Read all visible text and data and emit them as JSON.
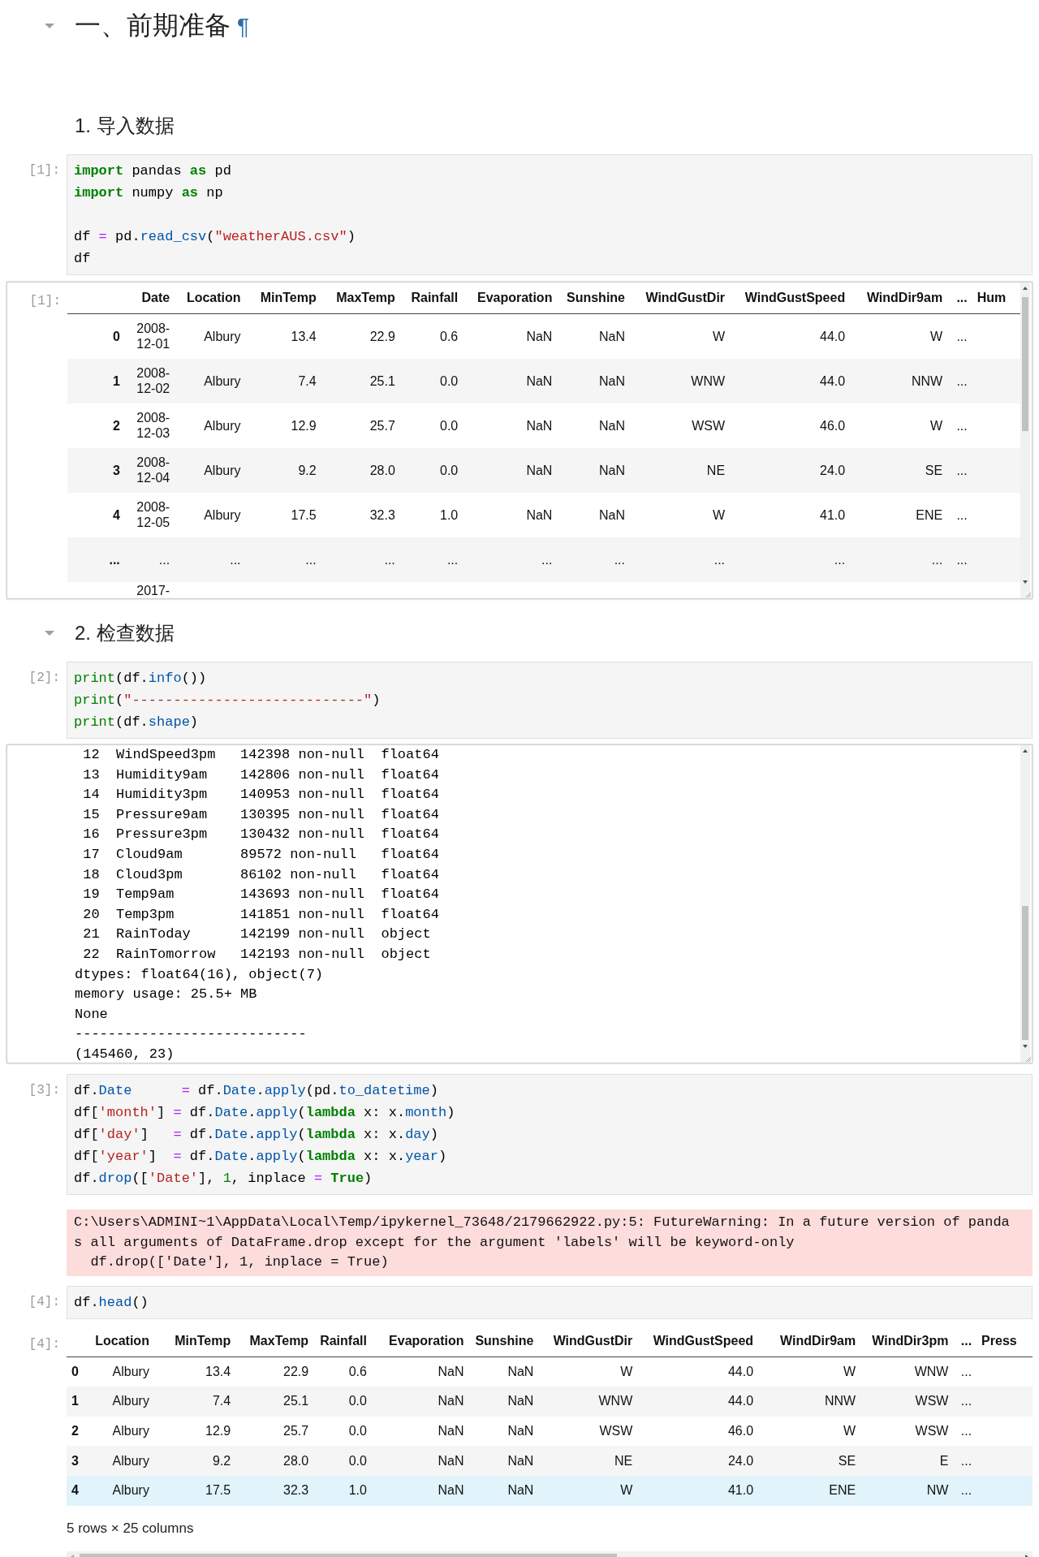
{
  "cells": [
    {
      "kind": "title",
      "text": "一、前期准备",
      "anchor": "¶",
      "expanded": true
    },
    {
      "kind": "section",
      "text": "1. 导入数据"
    },
    {
      "kind": "code",
      "prompt": "[1]:",
      "groups": [
        [
          [
            {
              "kind": "kw",
              "text": "import"
            },
            {
              "kind": "plain",
              "text": " pandas "
            },
            {
              "kind": "kw",
              "text": "as"
            },
            {
              "kind": "plain",
              "text": " pd"
            }
          ],
          [
            {
              "kind": "kw",
              "text": "import"
            },
            {
              "kind": "plain",
              "text": " numpy "
            },
            {
              "kind": "kw",
              "text": "as"
            },
            {
              "kind": "plain",
              "text": " np"
            }
          ]
        ],
        [
          [
            {
              "kind": "plain",
              "text": "df "
            },
            {
              "kind": "op",
              "text": "="
            },
            {
              "kind": "plain",
              "text": " pd."
            },
            {
              "kind": "fn",
              "text": "read_csv"
            },
            {
              "kind": "plain",
              "text": "("
            },
            {
              "kind": "str",
              "text": "\"weatherAUS.csv\""
            },
            {
              "kind": "plain",
              "text": ")"
            }
          ],
          [
            {
              "kind": "plain",
              "text": "df"
            }
          ]
        ]
      ]
    },
    {
      "kind": "scrolled_table",
      "prompt": "[1]:",
      "columns": [
        "Date",
        "Location",
        "MinTemp",
        "MaxTemp",
        "Rainfall",
        "Evaporation",
        "Sunshine",
        "WindGustDir",
        "WindGustSpeed",
        "WindDir9am",
        "...",
        "Hum"
      ],
      "rows": [
        {
          "index": "0",
          "cells": [
            "2008-12-01",
            "Albury",
            "13.4",
            "22.9",
            "0.6",
            "NaN",
            "NaN",
            "W",
            "44.0",
            "W",
            "..."
          ]
        },
        {
          "index": "1",
          "cells": [
            "2008-12-02",
            "Albury",
            "7.4",
            "25.1",
            "0.0",
            "NaN",
            "NaN",
            "WNW",
            "44.0",
            "NNW",
            "..."
          ]
        },
        {
          "index": "2",
          "cells": [
            "2008-12-03",
            "Albury",
            "12.9",
            "25.7",
            "0.0",
            "NaN",
            "NaN",
            "WSW",
            "46.0",
            "W",
            "..."
          ]
        },
        {
          "index": "3",
          "cells": [
            "2008-12-04",
            "Albury",
            "9.2",
            "28.0",
            "0.0",
            "NaN",
            "NaN",
            "NE",
            "24.0",
            "SE",
            "..."
          ]
        },
        {
          "index": "4",
          "cells": [
            "2008-12-05",
            "Albury",
            "17.5",
            "32.3",
            "1.0",
            "NaN",
            "NaN",
            "W",
            "41.0",
            "ENE",
            "..."
          ]
        },
        {
          "index": "...",
          "cells": [
            "...",
            "...",
            "...",
            "...",
            "...",
            "...",
            "...",
            "...",
            "...",
            "...",
            "..."
          ]
        },
        {
          "cells": [
            "2017-"
          ]
        }
      ]
    },
    {
      "kind": "section",
      "text": "2. 检查数据",
      "expanded": true
    },
    {
      "kind": "code",
      "prompt": "[2]:",
      "groups": [
        [
          [
            {
              "kind": "bi",
              "text": "print"
            },
            {
              "kind": "plain",
              "text": "(df."
            },
            {
              "kind": "fn",
              "text": "info"
            },
            {
              "kind": "plain",
              "text": "())"
            }
          ],
          [
            {
              "kind": "bi",
              "text": "print"
            },
            {
              "kind": "plain",
              "text": "("
            },
            {
              "kind": "str",
              "text": "\"----------------------------\""
            },
            {
              "kind": "plain",
              "text": ")"
            }
          ],
          [
            {
              "kind": "bi",
              "text": "print"
            },
            {
              "kind": "plain",
              "text": "(df."
            },
            {
              "kind": "fn",
              "text": "shape"
            },
            {
              "kind": "plain",
              "text": ")"
            }
          ]
        ]
      ]
    },
    {
      "kind": "stream",
      "lines": [
        " 12  WindSpeed3pm   142398 non-null  float64",
        " 13  Humidity9am    142806 non-null  float64",
        " 14  Humidity3pm    140953 non-null  float64",
        " 15  Pressure9am    130395 non-null  float64",
        " 16  Pressure3pm    130432 non-null  float64",
        " 17  Cloud9am       89572 non-null   float64",
        " 18  Cloud3pm       86102 non-null   float64",
        " 19  Temp9am        143693 non-null  float64",
        " 20  Temp3pm        141851 non-null  float64",
        " 21  RainToday      142199 non-null  object",
        " 22  RainTomorrow   142193 non-null  object",
        "dtypes: float64(16), object(7)",
        "memory usage: 25.5+ MB",
        "None",
        "----------------------------",
        "(145460, 23)"
      ]
    },
    {
      "kind": "code",
      "prompt": "[3]:",
      "groups": [
        [
          [
            {
              "kind": "plain",
              "text": "df."
            },
            {
              "kind": "fn",
              "text": "Date"
            },
            {
              "kind": "op",
              "text": "      ="
            },
            {
              "kind": "plain",
              "text": " df."
            },
            {
              "kind": "fn",
              "text": "Date"
            },
            {
              "kind": "plain",
              "text": "."
            },
            {
              "kind": "fn",
              "text": "apply"
            },
            {
              "kind": "plain",
              "text": "(pd."
            },
            {
              "kind": "fn",
              "text": "to_datetime"
            },
            {
              "kind": "plain",
              "text": ")"
            }
          ],
          [
            {
              "kind": "plain",
              "text": "df["
            },
            {
              "kind": "str",
              "text": "'month'"
            },
            {
              "kind": "plain",
              "text": "] "
            },
            {
              "kind": "op",
              "text": "="
            },
            {
              "kind": "plain",
              "text": " df."
            },
            {
              "kind": "fn",
              "text": "Date"
            },
            {
              "kind": "plain",
              "text": "."
            },
            {
              "kind": "fn",
              "text": "apply"
            },
            {
              "kind": "plain",
              "text": "("
            },
            {
              "kind": "kw",
              "text": "lambda"
            },
            {
              "kind": "plain",
              "text": " x: x."
            },
            {
              "kind": "fn",
              "text": "month"
            },
            {
              "kind": "plain",
              "text": ")"
            }
          ],
          [
            {
              "kind": "plain",
              "text": "df["
            },
            {
              "kind": "str",
              "text": "'day'"
            },
            {
              "kind": "plain",
              "text": "]   "
            },
            {
              "kind": "op",
              "text": "="
            },
            {
              "kind": "plain",
              "text": " df."
            },
            {
              "kind": "fn",
              "text": "Date"
            },
            {
              "kind": "plain",
              "text": "."
            },
            {
              "kind": "fn",
              "text": "apply"
            },
            {
              "kind": "plain",
              "text": "("
            },
            {
              "kind": "kw",
              "text": "lambda"
            },
            {
              "kind": "plain",
              "text": " x: x."
            },
            {
              "kind": "fn",
              "text": "day"
            },
            {
              "kind": "plain",
              "text": ")"
            }
          ],
          [
            {
              "kind": "plain",
              "text": "df["
            },
            {
              "kind": "str",
              "text": "'year'"
            },
            {
              "kind": "plain",
              "text": "]  "
            },
            {
              "kind": "op",
              "text": "="
            },
            {
              "kind": "plain",
              "text": " df."
            },
            {
              "kind": "fn",
              "text": "Date"
            },
            {
              "kind": "plain",
              "text": "."
            },
            {
              "kind": "fn",
              "text": "apply"
            },
            {
              "kind": "plain",
              "text": "("
            },
            {
              "kind": "kw",
              "text": "lambda"
            },
            {
              "kind": "plain",
              "text": " x: x."
            },
            {
              "kind": "fn",
              "text": "year"
            },
            {
              "kind": "plain",
              "text": ")"
            }
          ],
          [
            {
              "kind": "plain",
              "text": "df."
            },
            {
              "kind": "fn",
              "text": "drop"
            },
            {
              "kind": "plain",
              "text": "(["
            },
            {
              "kind": "str",
              "text": "'Date'"
            },
            {
              "kind": "plain",
              "text": "], "
            },
            {
              "kind": "num",
              "text": "1"
            },
            {
              "kind": "plain",
              "text": ", inplace "
            },
            {
              "kind": "op",
              "text": "= "
            },
            {
              "kind": "kw",
              "text": "True"
            },
            {
              "kind": "plain",
              "text": ")"
            }
          ]
        ]
      ]
    },
    {
      "kind": "stderr",
      "lines": [
        "C:\\Users\\ADMINI~1\\AppData\\Local\\Temp/ipykernel_73648/2179662922.py:5: FutureWarning: In a future version of panda",
        "s all arguments of DataFrame.drop except for the argument 'labels' will be keyword-only",
        "  df.drop(['Date'], 1, inplace = True)"
      ]
    },
    {
      "kind": "code",
      "prompt": "[4]:",
      "groups": [
        [
          [
            {
              "kind": "plain",
              "text": "df."
            },
            {
              "kind": "fn",
              "text": "head"
            },
            {
              "kind": "plain",
              "text": "()"
            }
          ]
        ]
      ]
    },
    {
      "kind": "table",
      "prompt": "[4]:",
      "footer": "5 rows × 25 columns",
      "columns": [
        "Location",
        "MinTemp",
        "MaxTemp",
        "Rainfall",
        "Evaporation",
        "Sunshine",
        "WindGustDir",
        "WindGustSpeed",
        "WindDir9am",
        "WindDir3pm",
        "...",
        "Press"
      ],
      "rows": [
        {
          "index": "0",
          "hovered": false,
          "cells": [
            "Albury",
            "13.4",
            "22.9",
            "0.6",
            "NaN",
            "NaN",
            "W",
            "44.0",
            "W",
            "WNW",
            "..."
          ]
        },
        {
          "index": "1",
          "hovered": false,
          "cells": [
            "Albury",
            "7.4",
            "25.1",
            "0.0",
            "NaN",
            "NaN",
            "WNW",
            "44.0",
            "NNW",
            "WSW",
            "..."
          ]
        },
        {
          "index": "2",
          "hovered": false,
          "cells": [
            "Albury",
            "12.9",
            "25.7",
            "0.0",
            "NaN",
            "NaN",
            "WSW",
            "46.0",
            "W",
            "WSW",
            "..."
          ]
        },
        {
          "index": "3",
          "hovered": false,
          "cells": [
            "Albury",
            "9.2",
            "28.0",
            "0.0",
            "NaN",
            "NaN",
            "NE",
            "24.0",
            "SE",
            "E",
            "..."
          ]
        },
        {
          "index": "4",
          "hovered": true,
          "cells": [
            "Albury",
            "17.5",
            "32.3",
            "1.0",
            "NaN",
            "NaN",
            "W",
            "41.0",
            "ENE",
            "NW",
            "..."
          ]
        }
      ]
    }
  ]
}
